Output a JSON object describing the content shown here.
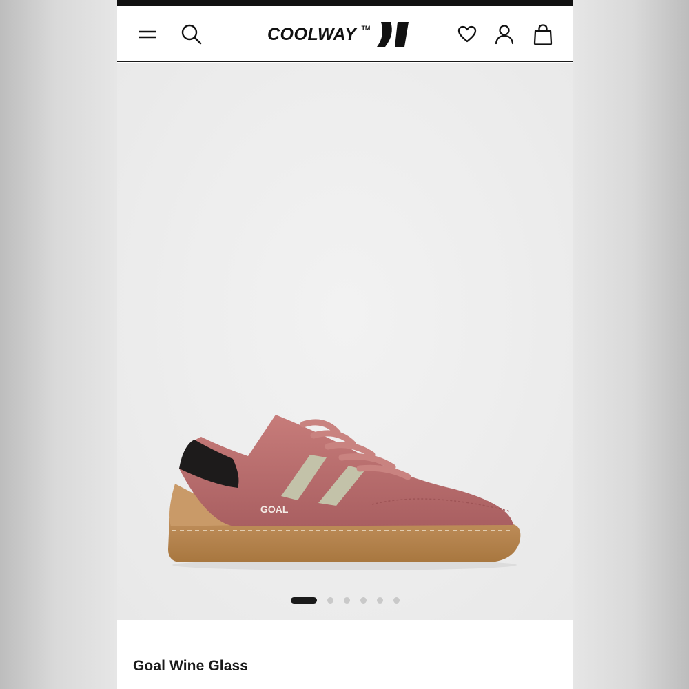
{
  "header": {
    "brand": "COOLWAY",
    "trademark": "TM",
    "icons": [
      "menu-icon",
      "search-icon",
      "heart-icon",
      "user-icon",
      "shopping-bag-icon"
    ]
  },
  "gallery": {
    "image_text": "GOAL",
    "slide_count": 6,
    "active_slide": 1
  },
  "product": {
    "name": "Goal Wine Glass"
  },
  "colors": {
    "accent": "#111111",
    "shoe_suede": "#bb6f70",
    "stripe": "#c3c2a9",
    "sole": "#b78552"
  }
}
